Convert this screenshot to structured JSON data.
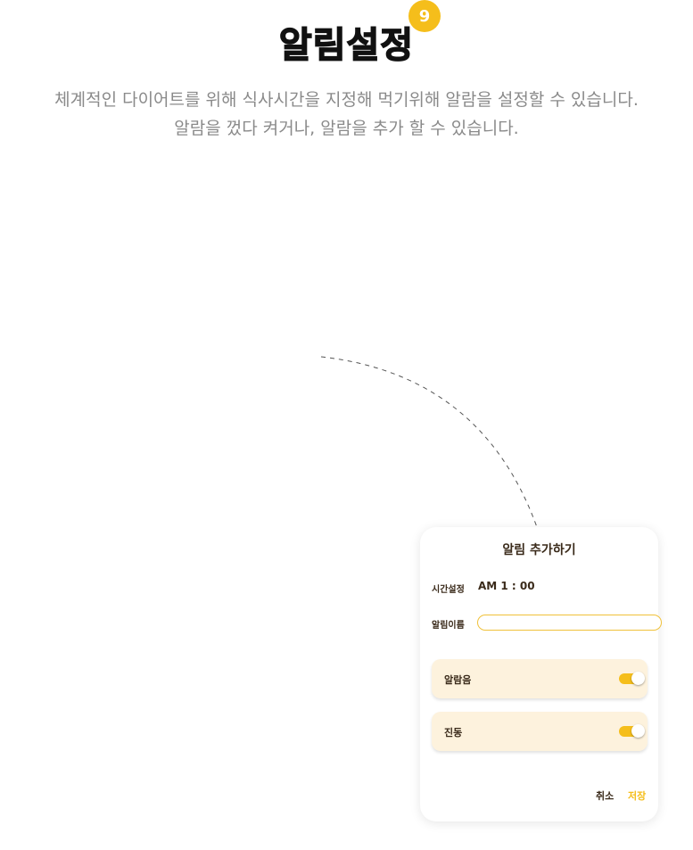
{
  "header": {
    "title": "알림설정",
    "badge": "9"
  },
  "description": {
    "line1": "체계적인 다이어트를 위해 식사시간을 지정해 먹기위해 알람을 설정할 수 있습니다.",
    "line2": "알람을 껐다 켜거나, 알람을 추가 할 수 있습니다."
  },
  "dialog": {
    "title": "알림 추가하기",
    "time_label": "시간설정",
    "time_value": "AM 1 : 00",
    "name_label": "알림이름",
    "name_value": "",
    "options": [
      {
        "label": "알람음",
        "enabled": true
      },
      {
        "label": "진동",
        "enabled": true
      }
    ],
    "cancel_label": "취소",
    "save_label": "저장"
  },
  "colors": {
    "accent": "#f5be1b",
    "card_bg": "#fdf2dd",
    "text_dark": "#3a2a1a",
    "text_muted": "#8a8a8a"
  }
}
